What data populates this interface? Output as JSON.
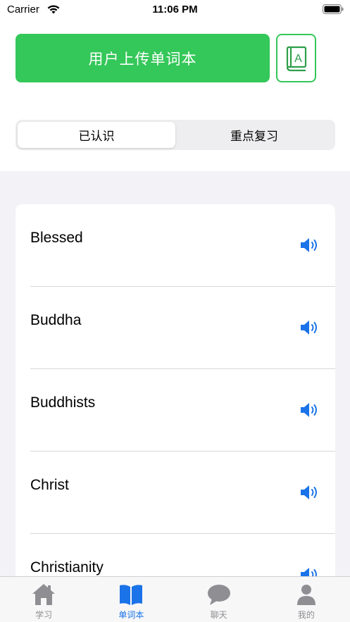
{
  "status_bar": {
    "carrier": "Carrier",
    "time": "11:06 PM"
  },
  "header": {
    "upload_label": "用户上传单词本",
    "dict_icon": "book-a-icon"
  },
  "segments": [
    {
      "label": "已认识",
      "active": true
    },
    {
      "label": "重点复习",
      "active": false
    }
  ],
  "words": [
    {
      "text": "Blessed"
    },
    {
      "text": "Buddha"
    },
    {
      "text": "Buddhists"
    },
    {
      "text": "Christ"
    },
    {
      "text": "Christianity"
    }
  ],
  "tabs": [
    {
      "label": "学习",
      "icon": "house-icon",
      "active": false
    },
    {
      "label": "单词本",
      "icon": "open-book-icon",
      "active": true
    },
    {
      "label": "聊天",
      "icon": "chat-bubble-icon",
      "active": false
    },
    {
      "label": "我的",
      "icon": "person-icon",
      "active": false
    }
  ],
  "colors": {
    "green": "#34c759",
    "blue": "#1a73e8",
    "gray": "#8e8e93"
  }
}
